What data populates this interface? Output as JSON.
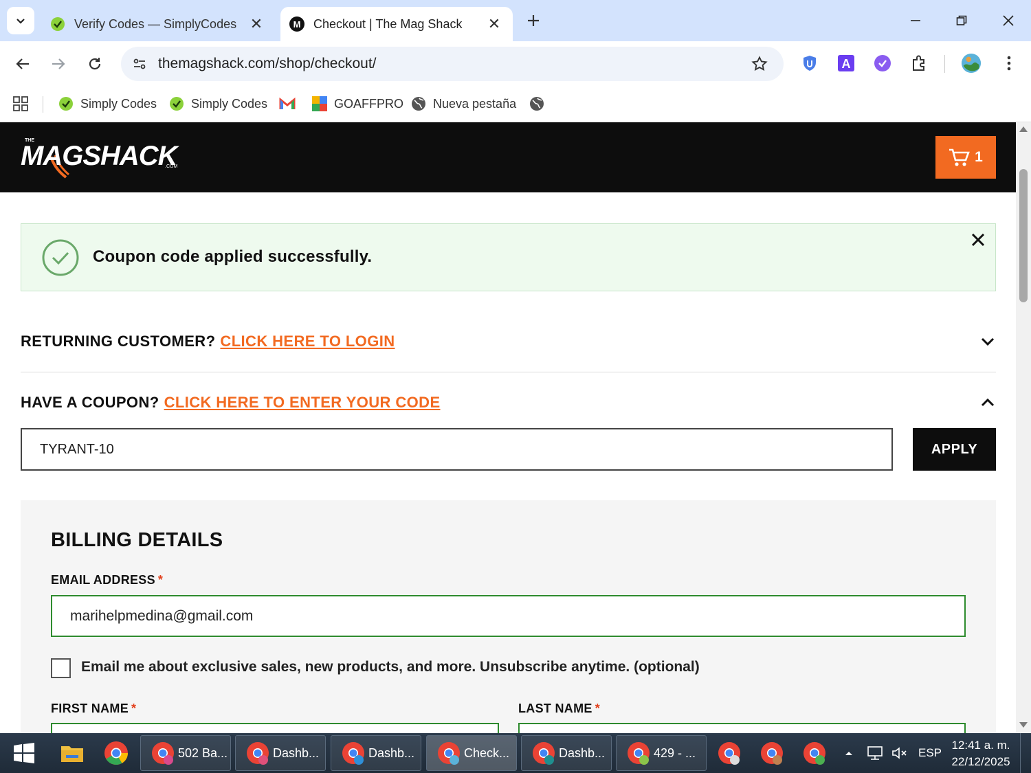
{
  "browser": {
    "tabs": [
      {
        "title": "Verify Codes — SimplyCodes"
      },
      {
        "title": "Checkout | The Mag Shack"
      }
    ],
    "url": "themagshack.com/shop/checkout/",
    "bookmarks": [
      {
        "label": "Simply Codes"
      },
      {
        "label": "Simply Codes"
      },
      {
        "label": ""
      },
      {
        "label": "GOAFFPRO"
      },
      {
        "label": "Nueva pestaña"
      },
      {
        "label": ""
      }
    ]
  },
  "site": {
    "logo_text": "MAGSHACK",
    "cart_count": "1"
  },
  "notice": {
    "message": "Coupon code applied successfully."
  },
  "returning": {
    "lead": "RETURNING CUSTOMER?",
    "link": "CLICK HERE TO LOGIN"
  },
  "coupon": {
    "lead": "HAVE A COUPON?",
    "link": "CLICK HERE TO ENTER YOUR CODE",
    "value": "TYRANT-10",
    "apply_label": "APPLY"
  },
  "billing": {
    "title": "BILLING DETAILS",
    "email_label": "EMAIL ADDRESS",
    "email_value": "marihelpmedina@gmail.com",
    "optin_label": "Email me about exclusive sales, new products, and more. Unsubscribe anytime. (optional)",
    "first_name_label": "FIRST NAME",
    "last_name_label": "LAST NAME",
    "required_mark": "*"
  },
  "taskbar": {
    "tasks": [
      {
        "label": "502 Ba..."
      },
      {
        "label": "Dashb..."
      },
      {
        "label": "Dashb..."
      },
      {
        "label": "Check..."
      },
      {
        "label": "Dashb..."
      },
      {
        "label": "429 - ..."
      }
    ],
    "language": "ESP",
    "time": "12:41 a. m.",
    "date": "22/12/2025"
  },
  "colors": {
    "accent": "#f26a21",
    "success_border": "#2e8b2e",
    "notice_bg": "#eefaee"
  }
}
